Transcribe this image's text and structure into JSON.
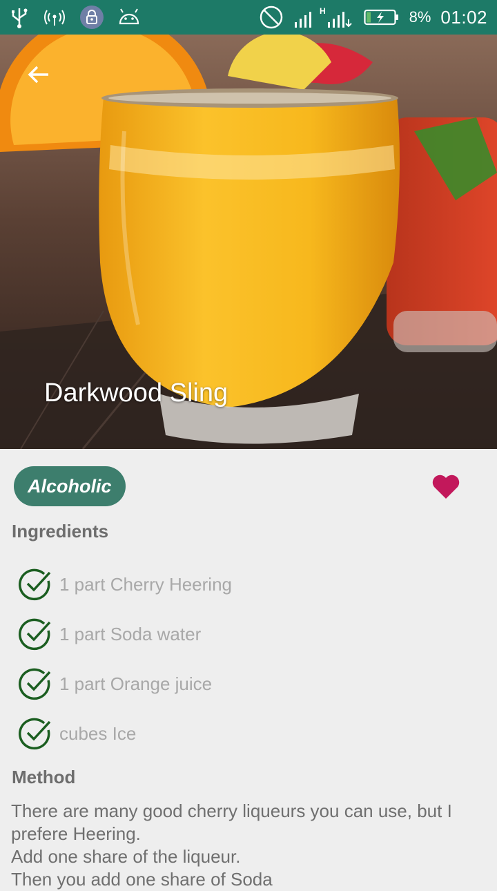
{
  "status_bar": {
    "battery_percent": "8%",
    "time": "01:02",
    "network_type": "H",
    "icons": [
      "usb-icon",
      "hotspot-icon",
      "lock-icon",
      "android-icon",
      "no-disturb-icon",
      "signal-icon",
      "battery-charging-icon"
    ]
  },
  "drink": {
    "title": "Darkwood Sling",
    "category": "Alcoholic",
    "favorite": true,
    "ingredients_heading": "Ingredients",
    "ingredients": [
      "1 part Cherry Heering",
      "1 part Soda water",
      "1 part Orange juice",
      "cubes Ice"
    ],
    "method_heading": "Method",
    "method": "There are many good cherry liqueurs you can use, but I prefere Heering.\nAdd one share of the liqueur.\nThen you add one share of Soda"
  },
  "colors": {
    "status_bar": "#1d7a67",
    "chip": "#3d7e6d",
    "heart": "#c2185b",
    "check": "#1b5e20"
  }
}
